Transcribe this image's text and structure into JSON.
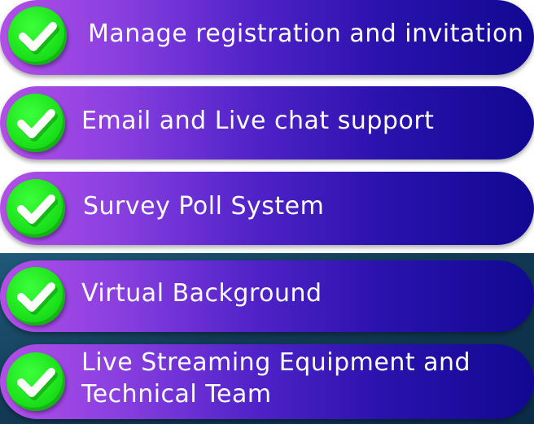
{
  "features": [
    {
      "label": "Manage registration and invitation",
      "icon": "checkmark-icon"
    },
    {
      "label": "Email and Live chat support",
      "icon": "checkmark-icon"
    },
    {
      "label": "Survey Poll System",
      "icon": "checkmark-icon"
    },
    {
      "label": "Virtual Background",
      "icon": "checkmark-icon"
    },
    {
      "label_line1": "Live Streaming Equipment and",
      "label_line2": "Technical Team",
      "icon": "checkmark-icon"
    }
  ],
  "colors": {
    "pill_start": "#b24fe6",
    "pill_end": "#110892",
    "check_green": "#1de41d",
    "text": "#ffffff",
    "background_bottom": "#1f5a78"
  }
}
